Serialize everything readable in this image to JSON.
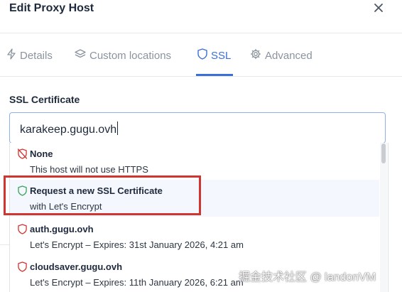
{
  "modal": {
    "title": "Edit Proxy Host",
    "close_icon": "close-icon"
  },
  "tabs": [
    {
      "label": "Details",
      "icon": "bolt-icon",
      "active": false
    },
    {
      "label": "Custom locations",
      "icon": "layers-icon",
      "active": false
    },
    {
      "label": "SSL",
      "icon": "shield-icon",
      "active": true
    },
    {
      "label": "Advanced",
      "icon": "gear-icon",
      "active": false
    }
  ],
  "ssl": {
    "label": "SSL Certificate",
    "input_value": "karakeep.gugu.ovh",
    "options": [
      {
        "title": "None",
        "subtitle": "This host will not use HTTPS",
        "icon": "shield-off-icon",
        "highlighted": false
      },
      {
        "title": "Request a new SSL Certificate",
        "subtitle": "with Let's Encrypt",
        "icon": "shield-icon",
        "highlighted": true
      },
      {
        "title": "auth.gugu.ovh",
        "subtitle": "Let's Encrypt – Expires: 31st January 2026, 4:21 am",
        "icon": "shield-icon",
        "highlighted": false
      },
      {
        "title": "cloudsaver.gugu.ovh",
        "subtitle": "Let's Encrypt – Expires: 11th January 2026, 6:21 am",
        "icon": "shield-icon",
        "highlighted": false
      }
    ]
  },
  "watermark": "掘金技术社区 @ landonVM",
  "colors": {
    "accent": "#3b6fd4",
    "shield_red": "#d0362f",
    "shield_green": "#3aa35a",
    "annotation_red": "#d0362f"
  }
}
